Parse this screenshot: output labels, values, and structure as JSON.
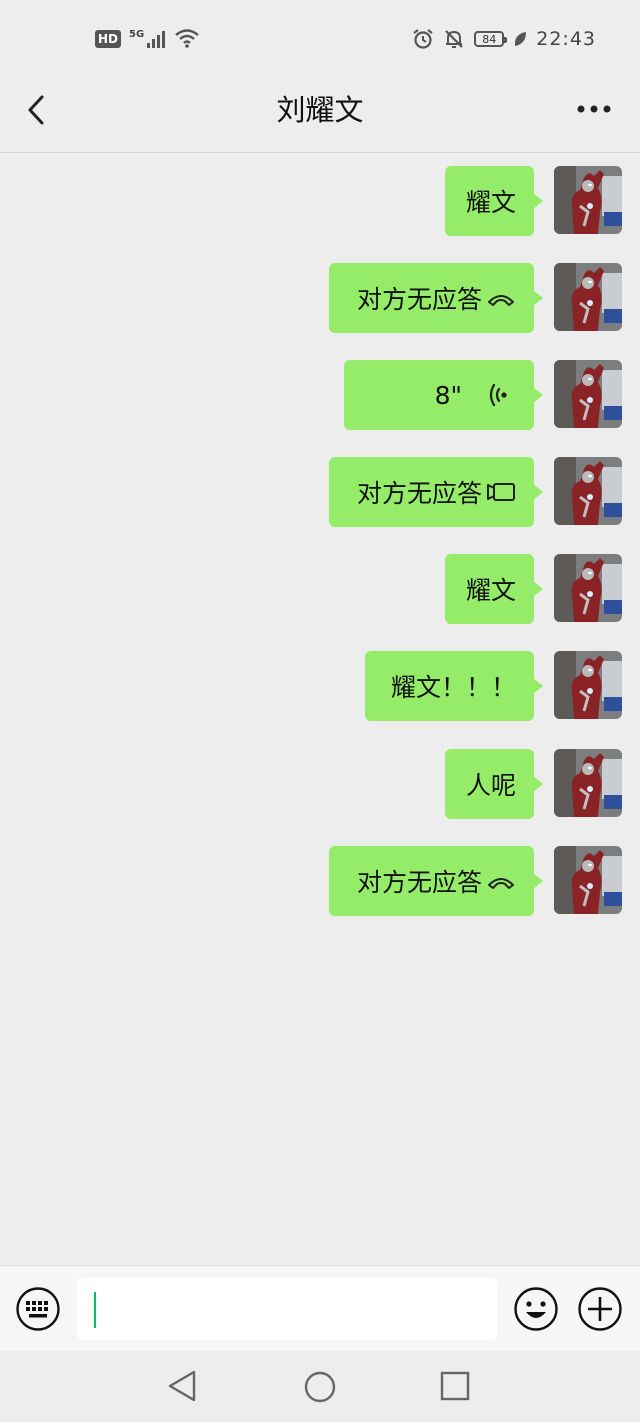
{
  "status_bar": {
    "hd_badge": "HD",
    "network": "5G",
    "battery_level": "84",
    "time": "22:43",
    "icons": [
      "signal-icon",
      "wifi-icon",
      "alarm-icon",
      "mute-bell-icon",
      "battery-icon",
      "leaf-icon"
    ]
  },
  "header": {
    "title": "刘耀文",
    "back_icon": "back-chevron-icon",
    "more_icon": "more-dots-icon"
  },
  "messages": [
    {
      "type": "text",
      "text": "耀文",
      "from": "me"
    },
    {
      "type": "call",
      "text": "对方无应答",
      "icon": "phone-hangup-icon",
      "from": "me"
    },
    {
      "type": "voice",
      "text": "8\"",
      "icon": "voice-wave-icon",
      "from": "me"
    },
    {
      "type": "call",
      "text": "对方无应答",
      "icon": "video-call-icon",
      "from": "me"
    },
    {
      "type": "text",
      "text": "耀文",
      "from": "me"
    },
    {
      "type": "text",
      "text": "耀文！！！",
      "from": "me"
    },
    {
      "type": "text",
      "text": "人呢",
      "from": "me"
    },
    {
      "type": "call",
      "text": "对方无应答",
      "icon": "phone-hangup-icon",
      "from": "me"
    }
  ],
  "input_bar": {
    "value": "",
    "icons": [
      "keyboard-icon",
      "emoji-icon",
      "plus-icon"
    ]
  },
  "nav_bar": {
    "icons": [
      "nav-back-icon",
      "nav-home-icon",
      "nav-recent-icon"
    ]
  },
  "colors": {
    "background": "#ededed",
    "bubble": "#95ec69",
    "cursor": "#07c160"
  }
}
